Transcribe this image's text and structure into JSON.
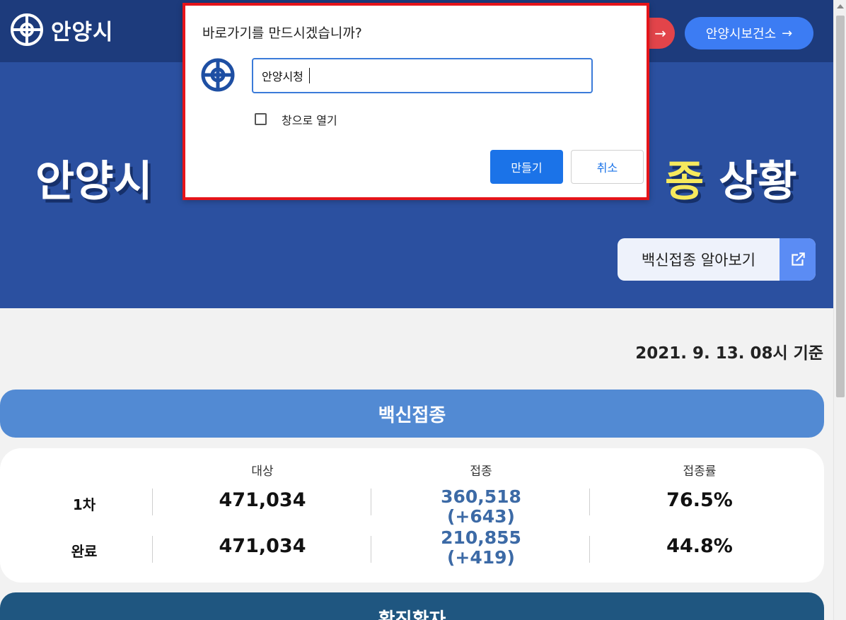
{
  "header": {
    "logo_text": "안양시",
    "red_pill_icon": "arrow-right-icon",
    "health_center_link": "안양시보건소",
    "health_center_icon": "arrow-right-icon"
  },
  "hero": {
    "title_left": "안양시",
    "title_highlight": "종",
    "title_right": "상황",
    "link_label": "백신접종 알아보기",
    "link_icon": "external-link-icon"
  },
  "status": {
    "as_of": "2021. 9. 13. 08시 기준"
  },
  "vaccine": {
    "section_title": "백신접종",
    "headers": [
      "대상",
      "접종",
      "접종률"
    ],
    "rows": [
      {
        "label": "1차",
        "target": "471,034",
        "done": "360,518",
        "delta": "(+643)",
        "rate": "76.5%"
      },
      {
        "label": "완료",
        "target": "471,034",
        "done": "210,855",
        "delta": "(+419)",
        "rate": "44.8%"
      }
    ]
  },
  "confirmed": {
    "section_title": "확진환자"
  },
  "dialog": {
    "title": "바로가기를 만드시겠습니까?",
    "name_value": "안양시청",
    "open_window_label": "창으로 열기",
    "open_window_checked": false,
    "create_label": "만들기",
    "cancel_label": "취소"
  },
  "colors": {
    "header_bg": "#1d3b7c",
    "hero_bg": "#2b50a0",
    "highlight": "#f6e95d",
    "accent_blue": "#1b73e8",
    "dialog_border": "#e5141a"
  }
}
